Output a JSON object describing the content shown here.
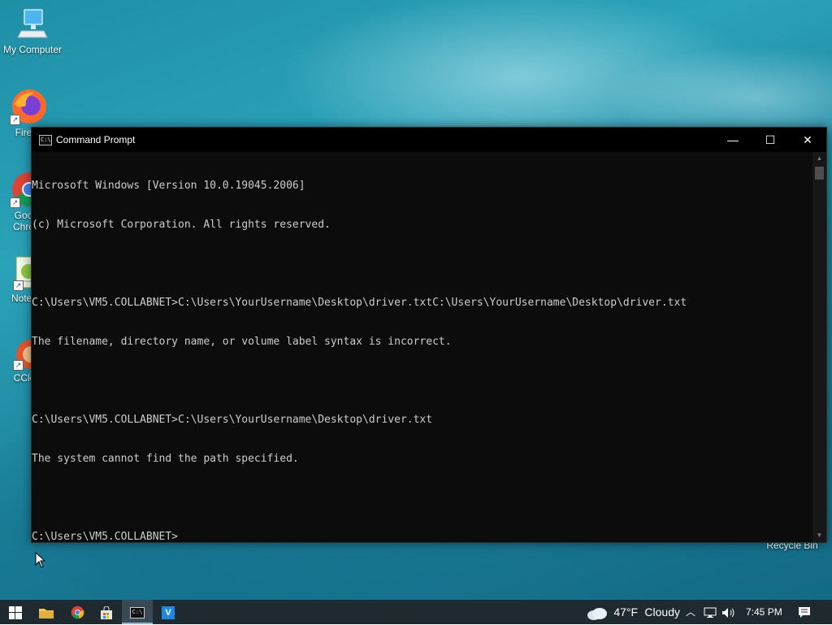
{
  "desktop": {
    "icons": [
      {
        "label": "My Computer"
      },
      {
        "label": "Fire"
      },
      {
        "label": "Goo\nChro"
      },
      {
        "label": "Notep"
      },
      {
        "label": "CCle"
      },
      {
        "label": "Recycle Bin"
      }
    ]
  },
  "window": {
    "title": "Command Prompt",
    "icon_text": "C:\\",
    "controls": {
      "minimize": "—",
      "maximize": "☐",
      "close": "✕"
    },
    "lines": [
      "Microsoft Windows [Version 10.0.19045.2006]",
      "(c) Microsoft Corporation. All rights reserved.",
      "",
      "C:\\Users\\VM5.COLLABNET>C:\\Users\\YourUsername\\Desktop\\driver.txtC:\\Users\\YourUsername\\Desktop\\driver.txt",
      "The filename, directory name, or volume label syntax is incorrect.",
      "",
      "C:\\Users\\VM5.COLLABNET>C:\\Users\\YourUsername\\Desktop\\driver.txt",
      "The system cannot find the path specified.",
      "",
      "C:\\Users\\VM5.COLLABNET>"
    ]
  },
  "taskbar": {
    "weather_temp": "47°F",
    "weather_desc": "Cloudy",
    "time": "7:45 PM",
    "vs_label": "V"
  }
}
